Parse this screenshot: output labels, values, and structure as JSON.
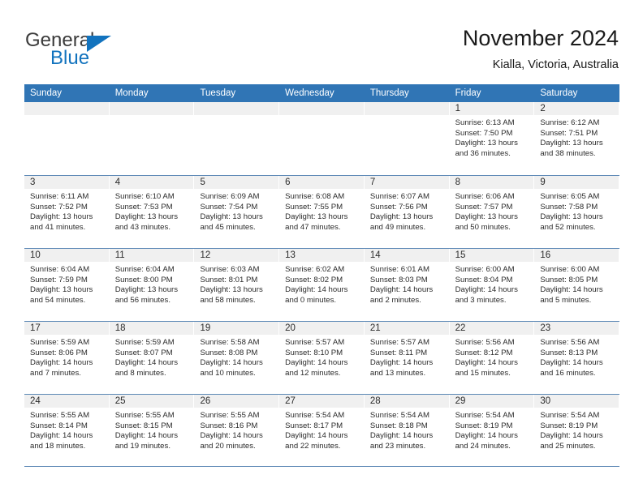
{
  "brand": {
    "name_part1": "General",
    "name_part2": "Blue",
    "color_primary": "#1273be"
  },
  "header": {
    "title": "November 2024",
    "subtitle": "Kialla, Victoria, Australia"
  },
  "calendar": {
    "header_bg": "#3075b5",
    "weekdays": [
      "Sunday",
      "Monday",
      "Tuesday",
      "Wednesday",
      "Thursday",
      "Friday",
      "Saturday"
    ],
    "weeks": [
      [
        {
          "day": "",
          "empty": true
        },
        {
          "day": "",
          "empty": true
        },
        {
          "day": "",
          "empty": true
        },
        {
          "day": "",
          "empty": true
        },
        {
          "day": "",
          "empty": true
        },
        {
          "day": "1",
          "sunrise": "Sunrise: 6:13 AM",
          "sunset": "Sunset: 7:50 PM",
          "daylight": "Daylight: 13 hours and 36 minutes."
        },
        {
          "day": "2",
          "sunrise": "Sunrise: 6:12 AM",
          "sunset": "Sunset: 7:51 PM",
          "daylight": "Daylight: 13 hours and 38 minutes."
        }
      ],
      [
        {
          "day": "3",
          "sunrise": "Sunrise: 6:11 AM",
          "sunset": "Sunset: 7:52 PM",
          "daylight": "Daylight: 13 hours and 41 minutes."
        },
        {
          "day": "4",
          "sunrise": "Sunrise: 6:10 AM",
          "sunset": "Sunset: 7:53 PM",
          "daylight": "Daylight: 13 hours and 43 minutes."
        },
        {
          "day": "5",
          "sunrise": "Sunrise: 6:09 AM",
          "sunset": "Sunset: 7:54 PM",
          "daylight": "Daylight: 13 hours and 45 minutes."
        },
        {
          "day": "6",
          "sunrise": "Sunrise: 6:08 AM",
          "sunset": "Sunset: 7:55 PM",
          "daylight": "Daylight: 13 hours and 47 minutes."
        },
        {
          "day": "7",
          "sunrise": "Sunrise: 6:07 AM",
          "sunset": "Sunset: 7:56 PM",
          "daylight": "Daylight: 13 hours and 49 minutes."
        },
        {
          "day": "8",
          "sunrise": "Sunrise: 6:06 AM",
          "sunset": "Sunset: 7:57 PM",
          "daylight": "Daylight: 13 hours and 50 minutes."
        },
        {
          "day": "9",
          "sunrise": "Sunrise: 6:05 AM",
          "sunset": "Sunset: 7:58 PM",
          "daylight": "Daylight: 13 hours and 52 minutes."
        }
      ],
      [
        {
          "day": "10",
          "sunrise": "Sunrise: 6:04 AM",
          "sunset": "Sunset: 7:59 PM",
          "daylight": "Daylight: 13 hours and 54 minutes."
        },
        {
          "day": "11",
          "sunrise": "Sunrise: 6:04 AM",
          "sunset": "Sunset: 8:00 PM",
          "daylight": "Daylight: 13 hours and 56 minutes."
        },
        {
          "day": "12",
          "sunrise": "Sunrise: 6:03 AM",
          "sunset": "Sunset: 8:01 PM",
          "daylight": "Daylight: 13 hours and 58 minutes."
        },
        {
          "day": "13",
          "sunrise": "Sunrise: 6:02 AM",
          "sunset": "Sunset: 8:02 PM",
          "daylight": "Daylight: 14 hours and 0 minutes."
        },
        {
          "day": "14",
          "sunrise": "Sunrise: 6:01 AM",
          "sunset": "Sunset: 8:03 PM",
          "daylight": "Daylight: 14 hours and 2 minutes."
        },
        {
          "day": "15",
          "sunrise": "Sunrise: 6:00 AM",
          "sunset": "Sunset: 8:04 PM",
          "daylight": "Daylight: 14 hours and 3 minutes."
        },
        {
          "day": "16",
          "sunrise": "Sunrise: 6:00 AM",
          "sunset": "Sunset: 8:05 PM",
          "daylight": "Daylight: 14 hours and 5 minutes."
        }
      ],
      [
        {
          "day": "17",
          "sunrise": "Sunrise: 5:59 AM",
          "sunset": "Sunset: 8:06 PM",
          "daylight": "Daylight: 14 hours and 7 minutes."
        },
        {
          "day": "18",
          "sunrise": "Sunrise: 5:59 AM",
          "sunset": "Sunset: 8:07 PM",
          "daylight": "Daylight: 14 hours and 8 minutes."
        },
        {
          "day": "19",
          "sunrise": "Sunrise: 5:58 AM",
          "sunset": "Sunset: 8:08 PM",
          "daylight": "Daylight: 14 hours and 10 minutes."
        },
        {
          "day": "20",
          "sunrise": "Sunrise: 5:57 AM",
          "sunset": "Sunset: 8:10 PM",
          "daylight": "Daylight: 14 hours and 12 minutes."
        },
        {
          "day": "21",
          "sunrise": "Sunrise: 5:57 AM",
          "sunset": "Sunset: 8:11 PM",
          "daylight": "Daylight: 14 hours and 13 minutes."
        },
        {
          "day": "22",
          "sunrise": "Sunrise: 5:56 AM",
          "sunset": "Sunset: 8:12 PM",
          "daylight": "Daylight: 14 hours and 15 minutes."
        },
        {
          "day": "23",
          "sunrise": "Sunrise: 5:56 AM",
          "sunset": "Sunset: 8:13 PM",
          "daylight": "Daylight: 14 hours and 16 minutes."
        }
      ],
      [
        {
          "day": "24",
          "sunrise": "Sunrise: 5:55 AM",
          "sunset": "Sunset: 8:14 PM",
          "daylight": "Daylight: 14 hours and 18 minutes."
        },
        {
          "day": "25",
          "sunrise": "Sunrise: 5:55 AM",
          "sunset": "Sunset: 8:15 PM",
          "daylight": "Daylight: 14 hours and 19 minutes."
        },
        {
          "day": "26",
          "sunrise": "Sunrise: 5:55 AM",
          "sunset": "Sunset: 8:16 PM",
          "daylight": "Daylight: 14 hours and 20 minutes."
        },
        {
          "day": "27",
          "sunrise": "Sunrise: 5:54 AM",
          "sunset": "Sunset: 8:17 PM",
          "daylight": "Daylight: 14 hours and 22 minutes."
        },
        {
          "day": "28",
          "sunrise": "Sunrise: 5:54 AM",
          "sunset": "Sunset: 8:18 PM",
          "daylight": "Daylight: 14 hours and 23 minutes."
        },
        {
          "day": "29",
          "sunrise": "Sunrise: 5:54 AM",
          "sunset": "Sunset: 8:19 PM",
          "daylight": "Daylight: 14 hours and 24 minutes."
        },
        {
          "day": "30",
          "sunrise": "Sunrise: 5:54 AM",
          "sunset": "Sunset: 8:19 PM",
          "daylight": "Daylight: 14 hours and 25 minutes."
        }
      ]
    ]
  }
}
